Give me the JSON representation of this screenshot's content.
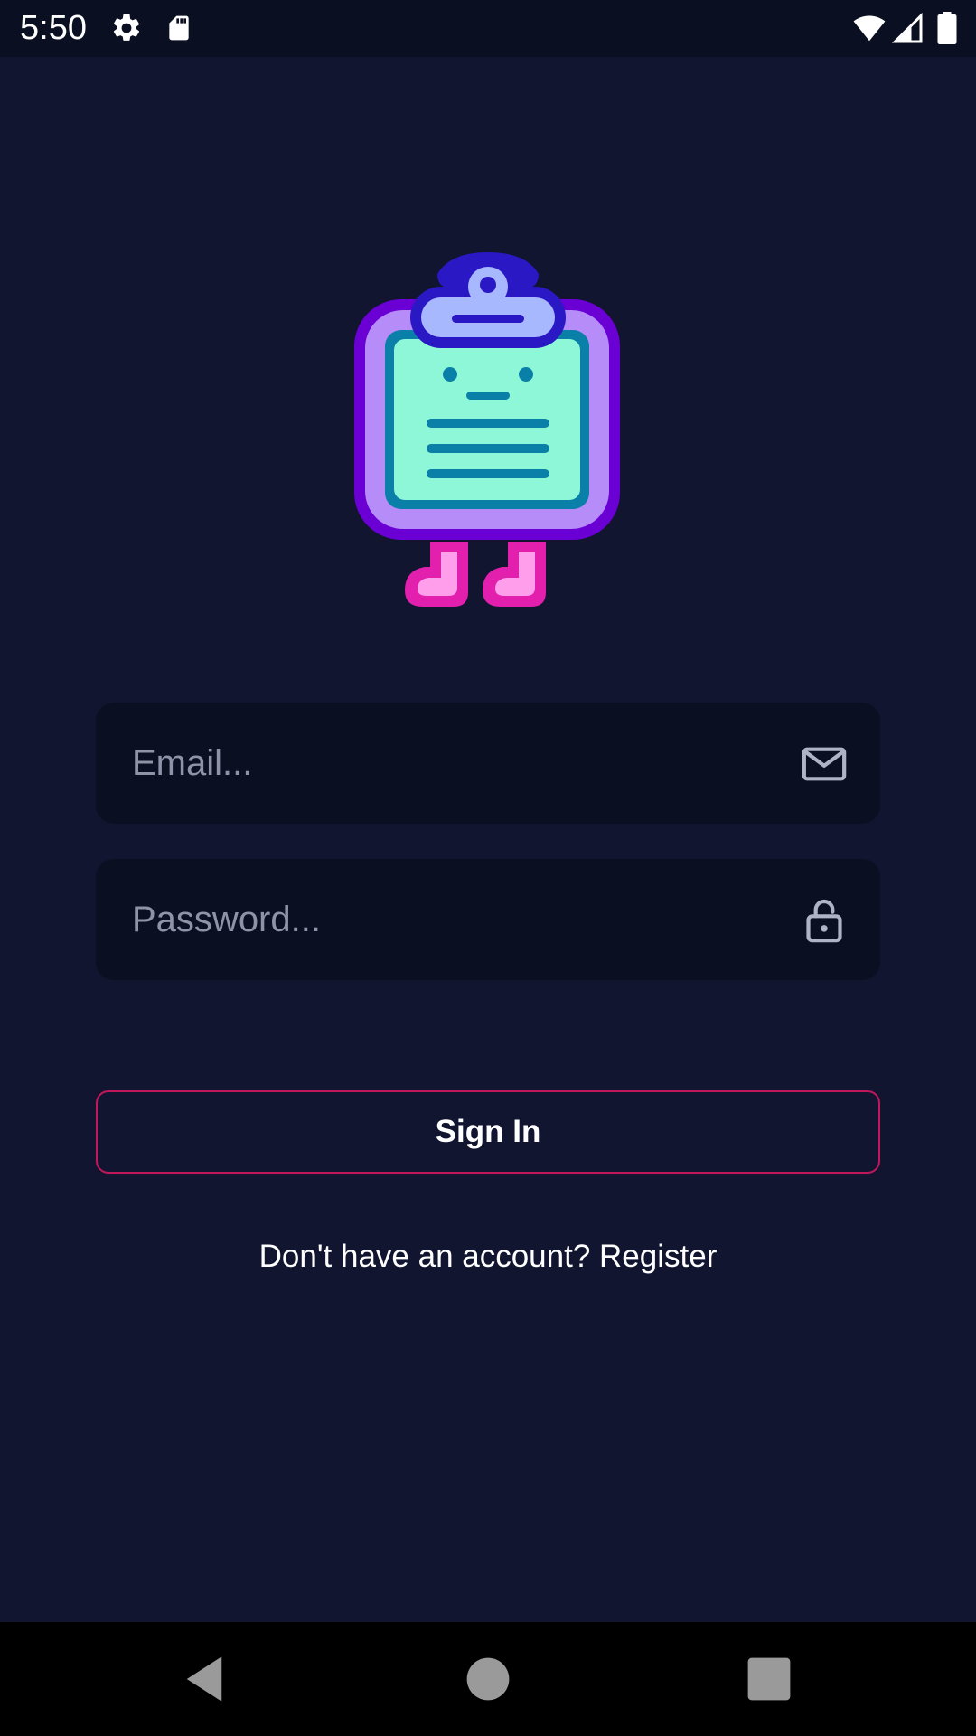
{
  "status_bar": {
    "time": "5:50",
    "icons": [
      "gear-icon",
      "sd-card-icon",
      "wifi-icon",
      "signal-icon",
      "battery-icon"
    ]
  },
  "logo": {
    "icon": "clipboard-mascot-icon"
  },
  "login_form": {
    "email": {
      "value": "",
      "placeholder": "Email...",
      "icon": "mail-icon"
    },
    "password": {
      "value": "",
      "placeholder": "Password...",
      "icon": "lock-icon"
    },
    "sign_in_label": "Sign In",
    "register_prompt": "Don't have an account? Register"
  },
  "nav_bar": {
    "icons": [
      "back-icon",
      "home-icon",
      "recents-icon"
    ]
  },
  "colors": {
    "background": "#111530",
    "field_background": "#0b0f22",
    "button_border": "#c2185b",
    "placeholder": "#8e93a7"
  }
}
